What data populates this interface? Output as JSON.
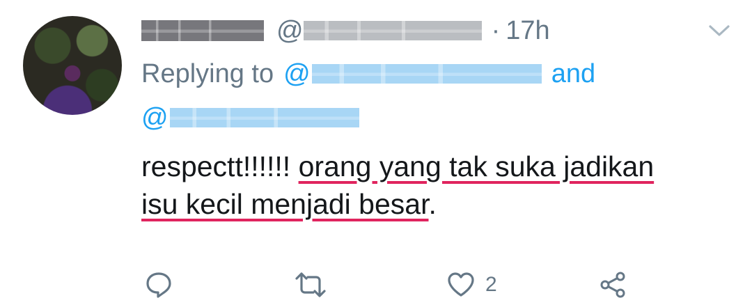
{
  "tweet": {
    "author_name": "",
    "handle_prefix": "@",
    "separator": "·",
    "timestamp": "17h",
    "replying_to_prefix": "Replying to",
    "mention_prefix_1": "@",
    "conjunction": "and",
    "mention_prefix_2": "@",
    "text_plain": "respectt!!!!!! ",
    "text_underlined_line1": "orang yang tak suka jadikan",
    "text_underlined_line2": "isu kecil menjadi besar",
    "text_end": ".",
    "underline_color": "#e0245e"
  },
  "actions": {
    "reply_icon": "reply-icon",
    "retweet_icon": "retweet-icon",
    "like_icon": "heart-icon",
    "like_count": "2",
    "share_icon": "share-icon"
  },
  "menu": {
    "icon": "chevron-down-icon"
  },
  "colors": {
    "link": "#1da1f2",
    "muted": "#657786",
    "text": "#14171a"
  }
}
